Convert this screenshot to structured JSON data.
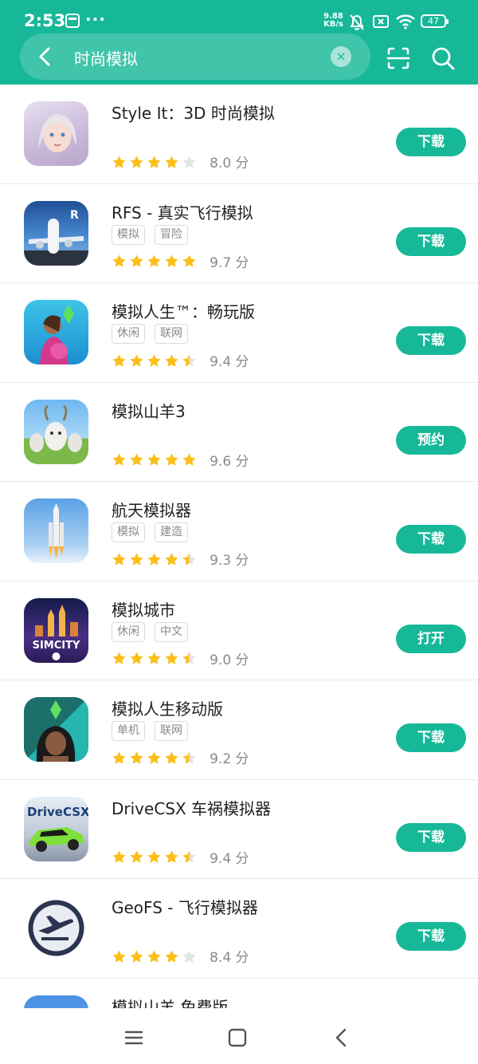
{
  "status": {
    "time": "2:53",
    "dots": "···",
    "speed_value": "9.88",
    "speed_unit": "KB/s",
    "battery": "47"
  },
  "search": {
    "query": "时尚模拟",
    "clear": "×"
  },
  "colors": {
    "accent": "#17b898",
    "star": "#fbbf1a",
    "star_empty": "#e3e3e3"
  },
  "apps": [
    {
      "name": "Style It：3D 时尚模拟",
      "tags": [],
      "stars": 4,
      "score": "8.0 分",
      "action": "下载"
    },
    {
      "name": "RFS - 真实飞行模拟",
      "tags": [
        "模拟",
        "冒险"
      ],
      "stars": 5,
      "score": "9.7 分",
      "action": "下载"
    },
    {
      "name": "模拟人生™：畅玩版",
      "tags": [
        "休闲",
        "联网"
      ],
      "stars": 4.5,
      "score": "9.4 分",
      "action": "下载"
    },
    {
      "name": "模拟山羊3",
      "tags": [],
      "stars": 5,
      "score": "9.6 分",
      "action": "预约"
    },
    {
      "name": "航天模拟器",
      "tags": [
        "模拟",
        "建造"
      ],
      "stars": 4.5,
      "score": "9.3 分",
      "action": "下载"
    },
    {
      "name": "模拟城市",
      "tags": [
        "休闲",
        "中文"
      ],
      "stars": 4.5,
      "score": "9.0 分",
      "action": "打开"
    },
    {
      "name": "模拟人生移动版",
      "tags": [
        "单机",
        "联网"
      ],
      "stars": 4.5,
      "score": "9.2 分",
      "action": "下载"
    },
    {
      "name": "DriveCSX 车祸模拟器",
      "tags": [],
      "stars": 4.5,
      "score": "9.4 分",
      "action": "下载"
    },
    {
      "name": "GeoFS - 飞行模拟器",
      "tags": [],
      "stars": 4,
      "score": "8.4 分",
      "action": "下载"
    },
    {
      "name": "模拟山羊 免费版",
      "tags": [],
      "stars": 0,
      "score": "",
      "action": ""
    }
  ],
  "icon_labels": {
    "simcity": "SIMCITY",
    "drivecsx": "DriveCSX",
    "rfs": "R"
  }
}
